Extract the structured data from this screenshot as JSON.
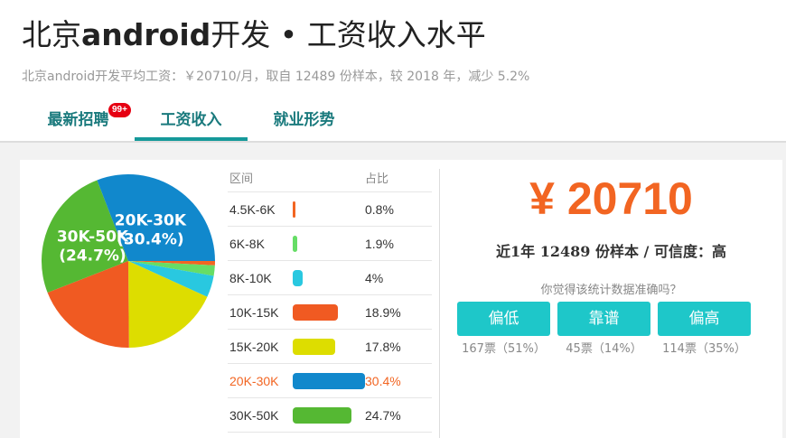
{
  "header": {
    "title_part1": "北京",
    "title_part2": "android",
    "title_part3": "开发 • 工资收入水平",
    "subtitle": "北京android开发平均工资：￥20710/月，取自 12489 份样本，较 2018 年，减少 5.2%"
  },
  "tabs": [
    {
      "label": "最新招聘",
      "badge": "99+"
    },
    {
      "label": "工资收入"
    },
    {
      "label": "就业形势"
    }
  ],
  "table": {
    "headers": [
      "区间",
      "占比"
    ],
    "rows": [
      {
        "range": "4.5K-6K",
        "pct": "0.8%",
        "value": 0.8,
        "color": "#f26522"
      },
      {
        "range": "6K-8K",
        "pct": "1.9%",
        "value": 1.9,
        "color": "#66dd66"
      },
      {
        "range": "8K-10K",
        "pct": "4%",
        "value": 4,
        "color": "#29c8e0"
      },
      {
        "range": "10K-15K",
        "pct": "18.9%",
        "value": 18.9,
        "color": "#f05a22"
      },
      {
        "range": "15K-20K",
        "pct": "17.8%",
        "value": 17.8,
        "color": "#dddd00"
      },
      {
        "range": "20K-30K",
        "pct": "30.4%",
        "value": 30.4,
        "color": "#1188cc",
        "highlight": true
      },
      {
        "range": "30K-50K",
        "pct": "24.7%",
        "value": 24.7,
        "color": "#55b833"
      }
    ]
  },
  "chart_data": {
    "type": "pie",
    "categories": [
      "4.5K-6K",
      "6K-8K",
      "8K-10K",
      "10K-15K",
      "15K-20K",
      "20K-30K",
      "30K-50K"
    ],
    "values": [
      0.8,
      1.9,
      4,
      18.9,
      17.8,
      30.4,
      24.7
    ],
    "colors": [
      "#f26522",
      "#66dd66",
      "#29c8e0",
      "#f05a22",
      "#dddd00",
      "#1188cc",
      "#55b833"
    ],
    "labels": [
      {
        "category": "20K-30K",
        "line1": "20K-30K",
        "line2": "(30.4%)"
      },
      {
        "category": "30K-50K",
        "line1": "30K-50K",
        "line2": "(24.7%)"
      }
    ]
  },
  "summary": {
    "salary": "¥ 20710",
    "sample_text": "近1年 12489 份样本 / 可信度：高",
    "question": "你觉得该统计数据准确吗？"
  },
  "votes": [
    {
      "label": "偏低",
      "count": "167票（51%）"
    },
    {
      "label": "靠谱",
      "count": "45票（14%）"
    },
    {
      "label": "偏高",
      "count": "114票（35%）"
    }
  ]
}
